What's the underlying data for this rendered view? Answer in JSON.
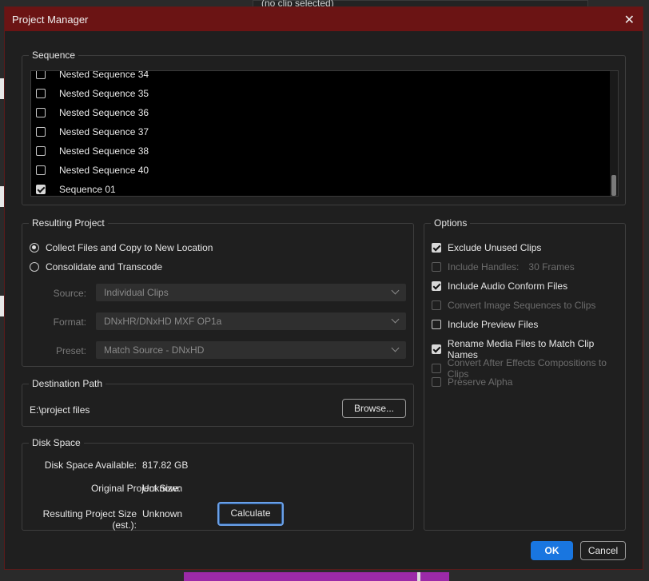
{
  "background": {
    "top_status": "(no clip selected)"
  },
  "dialog": {
    "title": "Project Manager"
  },
  "sequence": {
    "label": "Sequence",
    "items": [
      {
        "label": "Nested Sequence 34",
        "checked": false
      },
      {
        "label": "Nested Sequence 35",
        "checked": false
      },
      {
        "label": "Nested Sequence 36",
        "checked": false
      },
      {
        "label": "Nested Sequence 37",
        "checked": false
      },
      {
        "label": "Nested Sequence 38",
        "checked": false
      },
      {
        "label": "Nested Sequence 40",
        "checked": false
      },
      {
        "label": "Sequence 01",
        "checked": true
      }
    ]
  },
  "resulting_project": {
    "label": "Resulting Project",
    "collect_label": "Collect Files and Copy to New Location",
    "consolidate_label": "Consolidate and Transcode",
    "selected": "collect",
    "source_label": "Source:",
    "source_value": "Individual Clips",
    "format_label": "Format:",
    "format_value": "DNxHR/DNxHD MXF OP1a",
    "preset_label": "Preset:",
    "preset_value": "Match Source - DNxHD"
  },
  "destination": {
    "label": "Destination Path",
    "path": "E:\\project files",
    "browse_label": "Browse..."
  },
  "disk_space": {
    "label": "Disk Space",
    "available_label": "Disk Space Available:",
    "available_value": "817.82 GB",
    "original_label": "Original Project Size:",
    "original_value": "Unknown",
    "resulting_label": "Resulting Project Size (est.):",
    "resulting_value": "Unknown",
    "calculate_label": "Calculate"
  },
  "options": {
    "label": "Options",
    "exclude_unused": "Exclude Unused Clips",
    "include_handles": "Include Handles:",
    "handles_value": "30 Frames",
    "include_audio_conform": "Include Audio Conform Files",
    "convert_image_sequences": "Convert Image Sequences to Clips",
    "include_preview": "Include Preview Files",
    "rename_media": "Rename Media Files to Match Clip Names",
    "convert_ae": "Convert After Effects Compositions to Clips",
    "preserve_alpha": "Preserve Alpha"
  },
  "footer": {
    "ok_label": "OK",
    "cancel_label": "Cancel"
  },
  "colors": {
    "titlebar": "#6b1414",
    "accent": "#1976e0",
    "background": "#1f1f1f"
  }
}
